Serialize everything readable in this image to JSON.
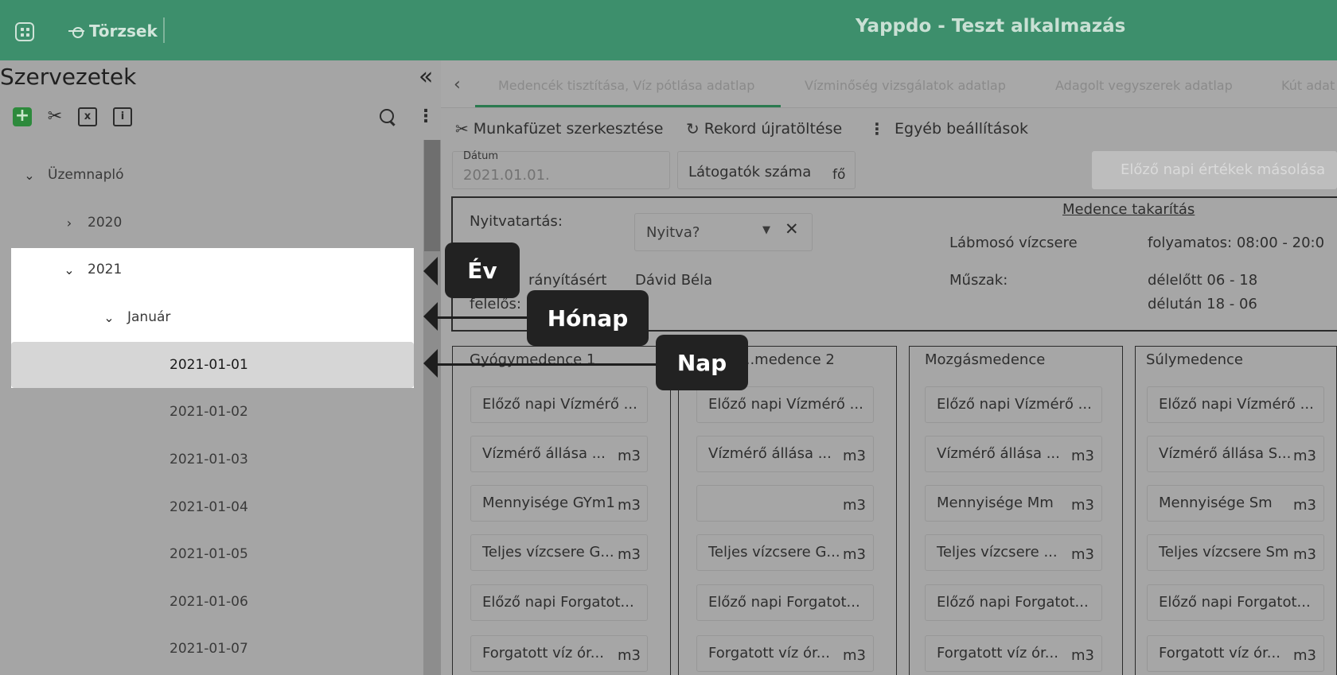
{
  "topbar": {
    "nav_label": "Törzsek",
    "app_title": "Yappdo - Teszt alkalmazás"
  },
  "sidebar": {
    "title": "Szervezetek",
    "tree": [
      {
        "label": "Üzemnapló",
        "expanded": true
      },
      {
        "label": "2020",
        "expanded": false
      },
      {
        "label": "2021",
        "expanded": true
      },
      {
        "label": "Január",
        "expanded": true
      },
      {
        "label": "2021-01-01",
        "selected": true
      },
      {
        "label": "2021-01-02"
      },
      {
        "label": "2021-01-03"
      },
      {
        "label": "2021-01-04"
      },
      {
        "label": "2021-01-05"
      },
      {
        "label": "2021-01-06"
      },
      {
        "label": "2021-01-07"
      }
    ]
  },
  "tabs": [
    {
      "label": "Medencék tisztítása, Víz pótlása adatlap",
      "active": true
    },
    {
      "label": "Vízminőség vizsgálatok adatlap"
    },
    {
      "label": "Adagolt vegyszerek adatlap"
    },
    {
      "label": "Kút adat"
    }
  ],
  "actions": {
    "edit": "Munkafüzet szerkesztése",
    "reload": "Rekord újratöltése",
    "more": "Egyéb beállítások"
  },
  "form": {
    "datum_label": "Dátum",
    "datum_value": "2021.01.01.",
    "visitors_label": "Látogatók száma",
    "visitors_unit": "fő",
    "copy_button": "Előző napi értékek másolása"
  },
  "info": {
    "opening_label": "Nyitvatartás:",
    "opening_placeholder": "Nyitva?",
    "responsible_label": "...rányításért felelős:",
    "responsible_label_line1": "rányításért",
    "responsible_label_line2": "felelős:",
    "responsible_value": "Dávid Béla",
    "cleaning_link": "Medence takarítás",
    "footbath_label": "Lábmosó vízcsere",
    "footbath_value": "folyamatos: 08:00 - 20:0",
    "shift_label": "Műszak:",
    "shift_morning": "délelőtt 06 - 18",
    "shift_afternoon": "délután 18 - 06"
  },
  "pools": [
    {
      "title": "Gyógymedence 1",
      "fields": [
        {
          "label": "Előző napi Vízmérő ...",
          "unit": ""
        },
        {
          "label": "Vízmérő állása ...",
          "unit": "m3"
        },
        {
          "label": "Mennyisége GYm1",
          "unit": "m3"
        },
        {
          "label": "Teljes vízcsere G...",
          "unit": "m3"
        },
        {
          "label": "Előző napi Forgatot...",
          "unit": ""
        },
        {
          "label": "Forgatott víz ór...",
          "unit": "m3"
        }
      ]
    },
    {
      "title": "...medence 2",
      "fields": [
        {
          "label": "Előző napi Vízmérő ...",
          "unit": ""
        },
        {
          "label": "Vízmérő állása ...",
          "unit": "m3"
        },
        {
          "label": "",
          "unit": "m3"
        },
        {
          "label": "Teljes vízcsere G...",
          "unit": "m3"
        },
        {
          "label": "Előző napi Forgatot...",
          "unit": ""
        },
        {
          "label": "Forgatott víz ór...",
          "unit": "m3"
        }
      ]
    },
    {
      "title": "Mozgásmedence",
      "fields": [
        {
          "label": "Előző napi Vízmérő ...",
          "unit": ""
        },
        {
          "label": "Vízmérő állása ...",
          "unit": "m3"
        },
        {
          "label": "Mennyisége Mm",
          "unit": "m3"
        },
        {
          "label": "Teljes vízcsere ...",
          "unit": "m3"
        },
        {
          "label": "Előző napi Forgatot...",
          "unit": ""
        },
        {
          "label": "Forgatott víz ór...",
          "unit": "m3"
        }
      ]
    },
    {
      "title": "Súlymedence",
      "fields": [
        {
          "label": "Előző napi Vízmérő ...",
          "unit": ""
        },
        {
          "label": "Vízmérő állása S...",
          "unit": "m3"
        },
        {
          "label": "Mennyisége Sm",
          "unit": "m3"
        },
        {
          "label": "Teljes vízcsere Sm",
          "unit": "m3"
        },
        {
          "label": "Előző napi Forgatot...",
          "unit": ""
        },
        {
          "label": "Forgatott víz ór...",
          "unit": "m3"
        }
      ]
    }
  ],
  "callouts": {
    "year": "Év",
    "month": "Hónap",
    "day": "Nap"
  },
  "colors": {
    "topbar": "#3d8f6c",
    "accent": "#2a7a4f",
    "callout": "#222222"
  }
}
